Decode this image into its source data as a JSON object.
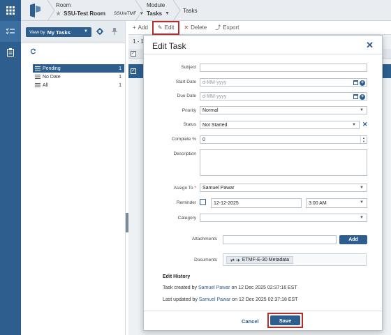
{
  "header": {
    "room_label": "Room",
    "room_name": "SSU-Test Room",
    "room_tag": "SSU/eTMF",
    "module_label": "Module",
    "module_name": "Tasks",
    "breadcrumb": "Tasks"
  },
  "filter_panel": {
    "view_by_label": "View by",
    "view_by_value": "My Tasks",
    "items": [
      {
        "label": "Pending",
        "count": "1"
      },
      {
        "label": "No Date",
        "count": "1"
      },
      {
        "label": "All",
        "count": "1"
      }
    ]
  },
  "toolbar": {
    "add_label": "Add",
    "edit_label": "Edit",
    "delete_label": "Delete",
    "export_label": "Export"
  },
  "grid": {
    "page_info": "1 - 1"
  },
  "modal": {
    "title": "Edit Task",
    "fields": {
      "subject_label": "Subject",
      "subject_value": "",
      "start_date_label": "Start Date",
      "start_date_placeholder": "d-MM-yyyy",
      "due_date_label": "Due Date",
      "due_date_placeholder": "d-MM-yyyy",
      "priority_label": "Priority",
      "priority_value": "Normal",
      "status_label": "Status",
      "status_value": "Not Started",
      "complete_label": "Complete %",
      "complete_value": "0",
      "description_label": "Description",
      "assign_to_label": "Assign To",
      "assign_to_required": "*",
      "assign_to_value": "Samuel Pawar",
      "reminder_label": "Reminder",
      "reminder_date": "12-12-2025",
      "reminder_time": "3:00 AM",
      "category_label": "Category",
      "category_value": "",
      "attachments_label": "Attachments",
      "attachments_add": "Add",
      "documents_label": "Documents",
      "document_name": "ETMF-E-30 Metadata"
    },
    "history": {
      "title": "Edit History",
      "created_prefix": "Task created by",
      "created_user": "Samuel Pawar",
      "created_suffix": "on 12 Dec 2025 02:37:16 EST",
      "updated_prefix": "Last updated by",
      "updated_user": "Samuel Pawar",
      "updated_suffix": "on 12 Dec 2025 02:37:18 EST"
    },
    "cancel_label": "Cancel",
    "save_label": "Save"
  },
  "colors": {
    "primary": "#2d5e8e",
    "highlight_border": "#b52f2f"
  }
}
